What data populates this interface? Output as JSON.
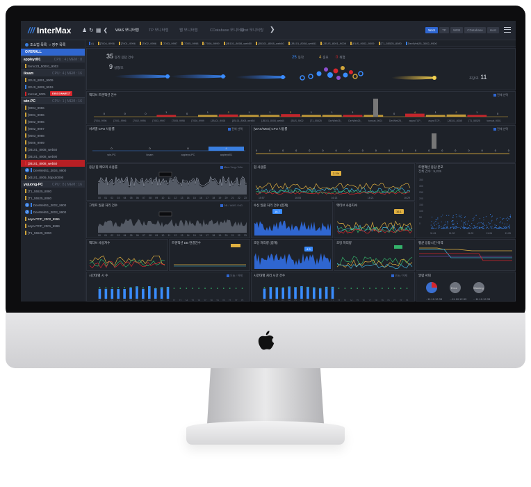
{
  "app": {
    "brand": "InterMax",
    "brand_mark": "///",
    "tabs": [
      {
        "label": "WAS 모니터링",
        "active": true
      },
      {
        "label": "TP 모니터링",
        "active": false
      },
      {
        "label": "웹 모니터링",
        "active": false
      },
      {
        "label": "CDatabase 모니터링",
        "active": false
      },
      {
        "label": "Host 모니터링",
        "active": false
      }
    ],
    "view_buttons": [
      {
        "label": "WAS",
        "active": true
      },
      {
        "label": "TP",
        "active": false
      },
      {
        "label": "WEB",
        "active": false
      },
      {
        "label": "CDatabase",
        "active": false
      },
      {
        "label": "Host",
        "active": false
      }
    ],
    "icons": [
      "user-icon",
      "refresh-icon",
      "grid-icon",
      "back-icon",
      "forward-icon",
      "hamburger-menu-icon"
    ]
  },
  "sidebar": {
    "header": [
      "조쇼법 목록",
      "영주 목록"
    ],
    "overall": "OVERALL",
    "groups": [
      {
        "name": "appleyd01",
        "meta": "CPU : 4 | MEM : 8",
        "items": [
          {
            "label": "Svmc23_50001_9003",
            "color": "#d1a63b"
          }
        ]
      },
      {
        "name": "iksam",
        "meta": "CPU : 4 | MEM : 16",
        "items": [
          {
            "label": "JEUS_8001_9009",
            "color": "#d1a63b"
          },
          {
            "label": "JEUS_9009_9019",
            "color": "#3a7fe0"
          },
          {
            "label": "tomcat_9001",
            "color": "#d6262c",
            "disconnect": "DISCONNECT"
          }
        ]
      },
      {
        "name": "win-PC",
        "meta": "CPU : 1 | MEM : 16",
        "items": [
          {
            "label": "[9004_9996",
            "color": "#d1a63b"
          },
          {
            "label": "[9001_9996",
            "color": "#d1a63b"
          },
          {
            "label": "[9002_9996",
            "color": "#d1a63b"
          },
          {
            "label": "[9002_9997",
            "color": "#d1a63b"
          },
          {
            "label": "[9003_9998",
            "color": "#d1a63b"
          },
          {
            "label": "[9006_9999",
            "color": "#d1a63b"
          },
          {
            "label": "[JB101_8008_web50",
            "color": "#d1a63b"
          },
          {
            "label": "[JB101_8008_web90",
            "color": "#d1a63b"
          },
          {
            "label": "[JB101_8008_web50",
            "color": "#d6262c",
            "selected": true
          },
          {
            "label": "DevWeb51_3004_9900",
            "color": "#3a7fe0",
            "num": "2"
          },
          {
            "label": "[xB101_8009_https50090",
            "color": "#d1a63b"
          }
        ]
      },
      {
        "name": "yejuong-PC",
        "meta": "CPU : 8 | MEM : 16",
        "items": [
          {
            "label": "[T1_55525_8080",
            "color": "#d1a63b"
          },
          {
            "label": "[T1_55525_8080",
            "color": "#d1a63b"
          },
          {
            "label": "DevWeb51_3002_9900",
            "color": "#3a7fe0",
            "num": "1"
          },
          {
            "label": "DevWeb51_3003_9900",
            "color": "#3a7fe0",
            "num": "2"
          },
          {
            "label": "asyncTCP_2002_9996",
            "color": "#d1a63b",
            "bold": true
          },
          {
            "label": "asyncTCP_2001_9999",
            "color": "#d1a63b"
          },
          {
            "label": "[T1_55525_9090",
            "color": "#d1a63b"
          }
        ]
      }
    ]
  },
  "filters": [
    {
      "label": "A|",
      "color": "#2f66d0"
    },
    {
      "label": "[7004_9996",
      "color": "#d1a63b"
    },
    {
      "label": "[7001_9996",
      "color": "#d1a63b"
    },
    {
      "label": "[7002_9996",
      "color": "#d1a63b"
    },
    {
      "label": "[7003_9997",
      "color": "#d1a63b"
    },
    {
      "label": "[7005_9998",
      "color": "#d1a63b"
    },
    {
      "label": "[7006_9999",
      "color": "#d1a63b"
    },
    {
      "label": "[JB101_8008_web50",
      "color": "#d1a63b"
    },
    {
      "label": "[JB101_8008_web60",
      "color": "#d1a63b"
    },
    {
      "label": "[JB101_8008_web51",
      "color": "#d1a63b"
    },
    {
      "label": "[JEUS_8001_9009",
      "color": "#d1a63b"
    },
    {
      "label": "[EUS_9002_9009",
      "color": "#d1a63b"
    },
    {
      "label": "[T1_55525_8080",
      "color": "#d1a63b"
    },
    {
      "label": "DevWeb25_3002_9900",
      "color": "#3a7fe0"
    }
  ],
  "flow": {
    "left_count": "35",
    "left_count_label": "동작 응답 건수",
    "left_sub": "9",
    "left_sub_label": "실행/초",
    "mid_a": "25",
    "mid_a_label": "동작",
    "mid_b": "4",
    "mid_b_label": "중요",
    "mid_c": "0",
    "mid_c_label": "위험",
    "right_label": "초당/초",
    "right_count": "11"
  },
  "panels": {
    "tx_count": {
      "title": "액티브 트랜잭션 건수",
      "check": "전체 선택"
    },
    "cpu": {
      "title": "서버별 CPU 사용률",
      "check": "전체 선택"
    },
    "cpu2": {
      "title": "[WAS/WEB] CPU 사용률",
      "check": "전체 선택"
    },
    "heap": {
      "title": "응답 힙 메모리 사용률",
      "legend": "Max / Avg / Min"
    },
    "heap2": {
      "title": "힙 사용률",
      "flag": "2.1%"
    },
    "resp": {
      "title": "트랜잭션 응답 분포",
      "sub": "전체 건수 : 5,215"
    },
    "tps": {
      "title": "그래프 일괄 처리 건수",
      "legend": "DB / WAS / NG"
    },
    "cpu_time": {
      "title": "수신 일괄 처리 건수 (합계)",
      "flag": "16.7"
    },
    "active_time": {
      "title": "액티브 사용자수",
      "flag": "16.1"
    },
    "err": {
      "title": "액티브 사용자수"
    },
    "db": {
      "title": "트랜잭션 DB 연결건수"
    },
    "gc": {
      "title": "초당 처리량 (합계)",
      "flag": "4.3"
    },
    "gc2": {
      "title": "초당 처리량"
    },
    "line5": {
      "title": "평균 응답시간 이력"
    },
    "hour_tx": {
      "title": "시간대별 시 수",
      "legend": "오늘 / 어제"
    },
    "hour_tx2": {
      "title": "시간대별 처리 시간 건수",
      "legend": "오늘 / 어제"
    },
    "alarm": {
      "title": "알람 서대",
      "pies": [
        "..11.10.12:33",
        "...11.10.12:33",
        "...11.10.12:33"
      ],
      "pie_labels": [
        "Error",
        "Error",
        "Warning"
      ]
    }
  },
  "labels": {
    "x_hours": [
      "00",
      "01",
      "02",
      "03",
      "04",
      "05",
      "06",
      "07",
      "08",
      "09",
      "10",
      "11",
      "12",
      "13",
      "14",
      "15",
      "16",
      "17",
      "18",
      "19",
      "20",
      "21",
      "22",
      "23"
    ],
    "time_axis_short": [
      "11:01",
      "11:02",
      "11:03",
      "11:04",
      "11:05"
    ],
    "time_axis_b": [
      "15:57",
      "16:05",
      "16:13",
      "16:21",
      "16:29"
    ],
    "cpu_servers": [
      "win-PC",
      "iksam",
      "appleyd-PC",
      "appleyd01"
    ],
    "cpu_values": [
      0,
      0,
      0,
      4
    ],
    "tx_cats": [
      "[7004_9996",
      "[7001_9996",
      "[7002_9996",
      "[7003_9997",
      "[7005_9998",
      "[7006_9999",
      "[JB101_9008",
      "[JB101_8008_web50",
      "[JB101_8008_web60",
      "[EUS_9002",
      "[T1_55525",
      "DevWeb25_",
      "DevWeb25_",
      "tomcat_9001",
      "DevWeb25_",
      "asyncTCP_",
      "asyncTCP_",
      "[JB101_8008",
      "[T1_55525",
      "tomcat_9001"
    ],
    "tx_values": [
      0,
      0,
      0,
      1,
      0,
      1,
      2,
      1,
      1,
      3,
      1,
      1,
      1,
      1,
      0,
      4,
      1,
      2,
      1,
      0
    ],
    "cpu2_vals": [
      "0",
      "0",
      "0",
      "0",
      "0",
      "0",
      "0",
      "0",
      "0",
      "0",
      "0",
      "0",
      "0",
      "0",
      "0",
      "0",
      "0",
      "0",
      "0",
      "0"
    ],
    "resp_y": [
      "350",
      "300",
      "250",
      "200",
      "150",
      "100",
      "50",
      "0"
    ],
    "heap_y": [
      "400",
      "200",
      "0"
    ],
    "hour_y": [
      "40",
      "35",
      "30",
      "25",
      "20",
      "15",
      "10",
      "5",
      "0"
    ]
  },
  "colors": {
    "accent": "#2f66d0",
    "gold": "#d1a63b",
    "red": "#d6262c",
    "green": "#34b26a",
    "cyan": "#3fb0d8"
  }
}
